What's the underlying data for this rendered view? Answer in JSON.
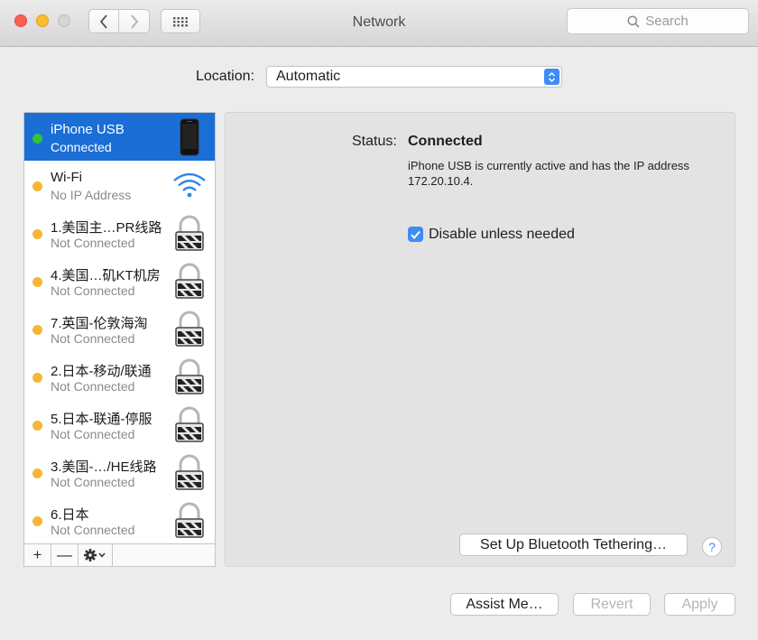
{
  "window": {
    "title": "Network",
    "search_placeholder": "Search"
  },
  "location": {
    "label": "Location:",
    "value": "Automatic"
  },
  "services": [
    {
      "name": "iPhone USB",
      "status": "Connected",
      "dot": "green",
      "icon": "iphone-icon",
      "selected": true
    },
    {
      "name": "Wi-Fi",
      "status": "No IP Address",
      "dot": "yellow",
      "icon": "wifi-icon",
      "selected": false
    },
    {
      "name": "1.美国主…PR线路",
      "status": "Not Connected",
      "dot": "yellow",
      "icon": "vpn-lock-icon",
      "selected": false
    },
    {
      "name": "4.美国…矶KT机房",
      "status": "Not Connected",
      "dot": "yellow",
      "icon": "vpn-lock-icon",
      "selected": false
    },
    {
      "name": "7.英国-伦敦海淘",
      "status": "Not Connected",
      "dot": "yellow",
      "icon": "vpn-lock-icon",
      "selected": false
    },
    {
      "name": "2.日本-移动/联通",
      "status": "Not Connected",
      "dot": "yellow",
      "icon": "vpn-lock-icon",
      "selected": false
    },
    {
      "name": "5.日本-联通-停服",
      "status": "Not Connected",
      "dot": "yellow",
      "icon": "vpn-lock-icon",
      "selected": false
    },
    {
      "name": "3.美国-…/HE线路",
      "status": "Not Connected",
      "dot": "yellow",
      "icon": "vpn-lock-icon",
      "selected": false
    },
    {
      "name": "6.日本",
      "status": "Not Connected",
      "dot": "yellow",
      "icon": "vpn-lock-icon",
      "selected": false
    }
  ],
  "sidebar_toolbar": {
    "add": "+",
    "remove": "—"
  },
  "detail": {
    "status_label": "Status:",
    "status_value": "Connected",
    "description": "iPhone USB is currently active and has the IP address 172.20.10.4.",
    "disable_checkbox": {
      "label": "Disable unless needed",
      "checked": true
    },
    "bluetooth_button": "Set Up Bluetooth Tethering…",
    "help": "?"
  },
  "footer": {
    "assist": "Assist Me…",
    "revert": "Revert",
    "apply": "Apply"
  },
  "colors": {
    "selection": "#1a6ed6",
    "accent": "#3e8cf6",
    "connected_dot": "#33c23c",
    "inactive_dot": "#f6b635"
  }
}
